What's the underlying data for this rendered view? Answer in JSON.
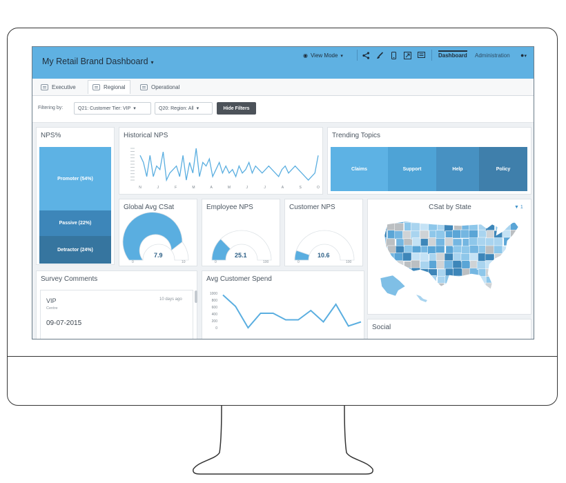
{
  "app": {
    "title": "My Retail Brand Dashboard",
    "view_mode": "View Mode",
    "nav": [
      "Dashboard",
      "Administration"
    ]
  },
  "tabs": [
    {
      "label": "Executive",
      "active": false
    },
    {
      "label": "Regional",
      "active": true
    },
    {
      "label": "Operational",
      "active": false
    }
  ],
  "filters": {
    "label": "Filtering by:",
    "items": [
      "Q21: Customer Tier: VIP",
      "Q20: Region: All"
    ],
    "hide_button": "Hide Filters"
  },
  "nps": {
    "title": "NPS%",
    "promoter": "Promoter (54%)",
    "passive": "Passive (22%)",
    "detractor": "Detractor (24%)",
    "promoter_pct": 54,
    "passive_pct": 22,
    "detractor_pct": 24
  },
  "historical_nps": {
    "title": "Historical NPS",
    "months": [
      "N",
      "J",
      "F",
      "M",
      "A",
      "M",
      "J",
      "J",
      "A",
      "S",
      "O"
    ],
    "values": [
      8,
      6,
      2,
      8,
      2,
      5,
      4,
      9,
      1,
      3,
      4,
      5,
      2,
      8,
      1,
      6,
      3,
      10,
      2,
      6,
      5,
      7,
      2,
      4,
      6,
      3,
      5,
      3,
      4,
      2,
      5,
      3,
      4,
      6,
      3,
      5,
      4,
      3,
      4,
      5,
      4,
      3,
      2,
      4,
      5,
      3,
      4,
      5,
      4,
      3,
      2,
      1,
      2,
      3,
      8
    ]
  },
  "trending_topics": {
    "title": "Trending Topics",
    "topics": [
      {
        "label": "Claims",
        "color": "#5db2e4"
      },
      {
        "label": "Support",
        "color": "#4ea3d6"
      },
      {
        "label": "Help",
        "color": "#4791c2"
      },
      {
        "label": "Policy",
        "color": "#3f7fab"
      }
    ]
  },
  "gauges": [
    {
      "title": "Global Avg CSat",
      "value": "7.9",
      "min": "0",
      "max": "10",
      "fraction": 0.79
    },
    {
      "title": "Employee NPS",
      "value": "25.1",
      "min": "0",
      "max": "100",
      "fraction": 0.251
    },
    {
      "title": "Customer NPS",
      "value": "10.6",
      "min": "0",
      "max": "100",
      "fraction": 0.106
    }
  ],
  "csat_by_state": {
    "title": "CSat by State",
    "filter_badge": "1"
  },
  "survey_comments": {
    "title": "Survey Comments",
    "tier": "VIP",
    "location": "Centre",
    "time_ago": "10 days ago",
    "date": "09-07-2015"
  },
  "avg_customer_spend": {
    "title": "Avg Customer Spend",
    "yticks": [
      "1000",
      "800",
      "600",
      "400",
      "200",
      "0"
    ]
  },
  "social": {
    "title": "Social"
  },
  "chart_data": {
    "type": "line",
    "title": "Avg Customer Spend",
    "ylim": [
      0,
      1000
    ],
    "x": [
      1,
      2,
      3,
      4,
      5,
      6,
      7,
      8,
      9,
      10,
      11,
      12
    ],
    "values": [
      950,
      620,
      0,
      420,
      420,
      230,
      230,
      500,
      170,
      680,
      50,
      170
    ]
  }
}
